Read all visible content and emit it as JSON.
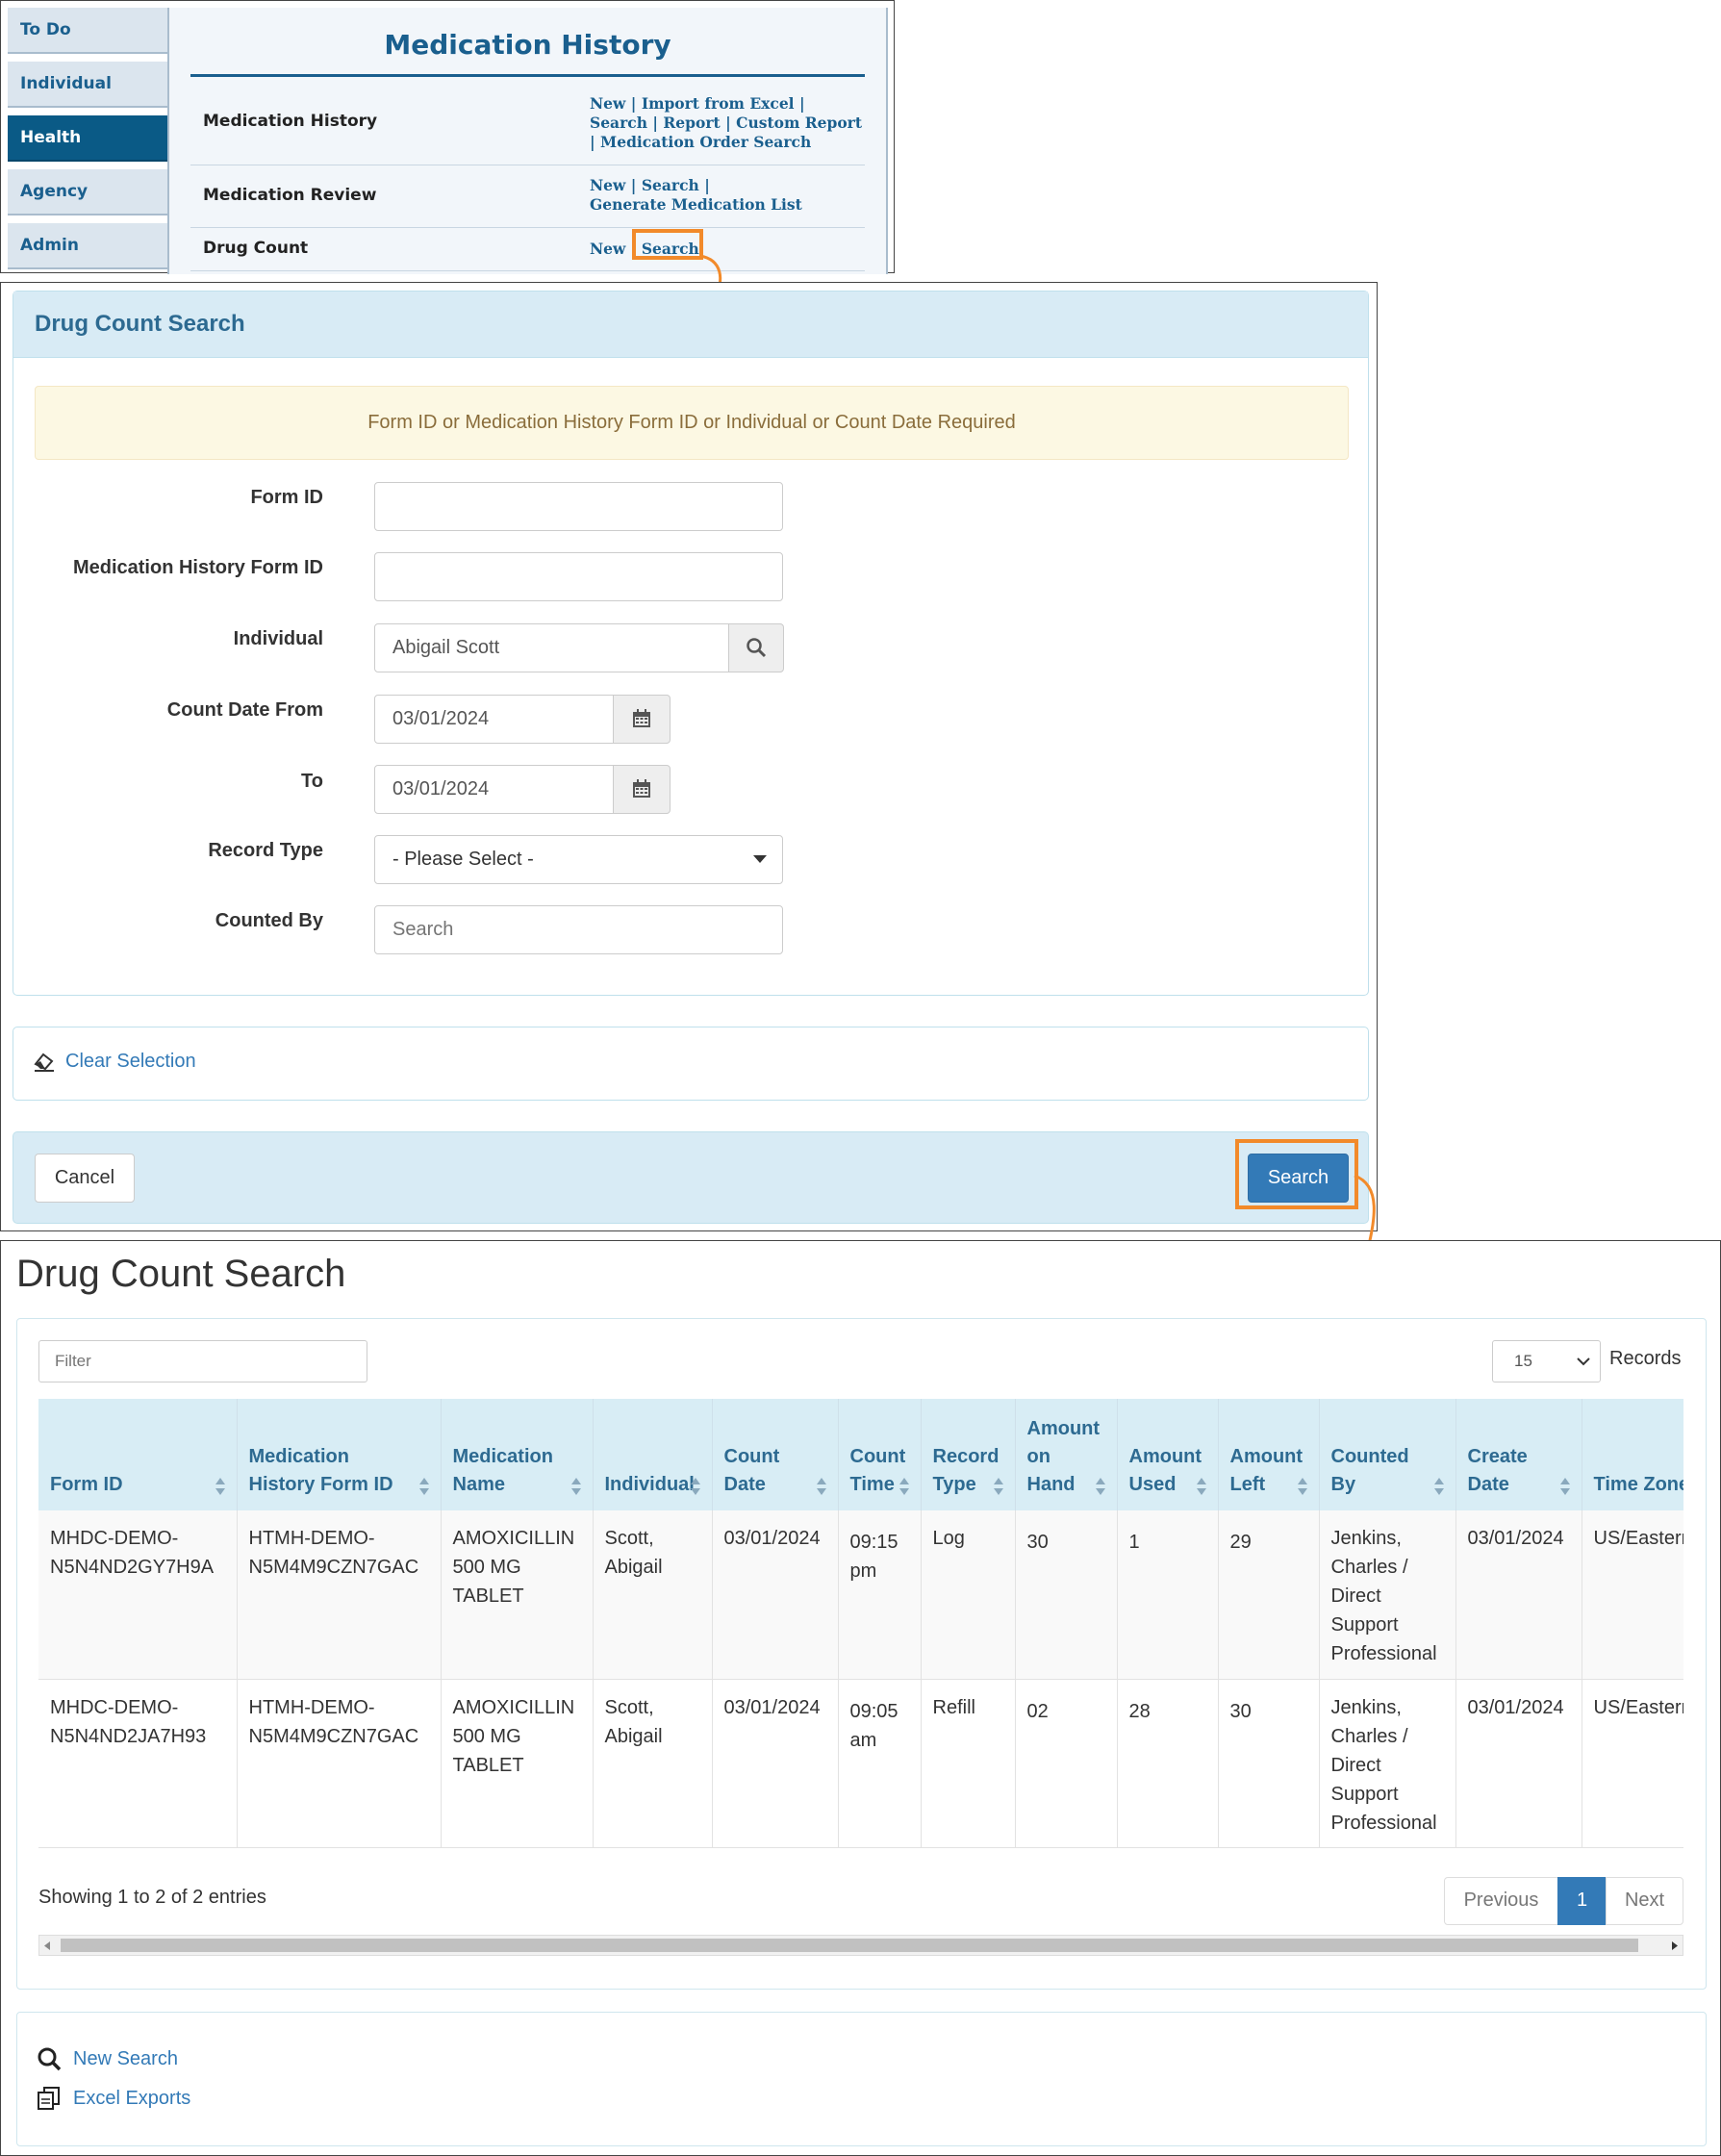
{
  "nav": {
    "tabs": [
      {
        "label": "To Do"
      },
      {
        "label": "Individual"
      },
      {
        "label": "Health"
      },
      {
        "label": "Agency"
      },
      {
        "label": "Admin"
      }
    ],
    "active": "Health"
  },
  "medication_history": {
    "title": "Medication History",
    "rows": [
      {
        "label": "Medication History",
        "links": [
          "New",
          "Import from Excel",
          "Search",
          "Report",
          "Custom Report",
          "Medication Order Search"
        ]
      },
      {
        "label": "Medication Review",
        "links": [
          "New",
          "Search",
          "Generate Medication List"
        ]
      },
      {
        "label": "Drug Count",
        "links": [
          "New",
          "Search"
        ]
      }
    ]
  },
  "search_form": {
    "title": "Drug Count Search",
    "alert": "Form ID or Medication History Form ID or Individual or Count Date Required",
    "fields": {
      "form_id": {
        "label": "Form ID",
        "value": ""
      },
      "med_history_form_id": {
        "label": "Medication History Form ID",
        "value": ""
      },
      "individual": {
        "label": "Individual",
        "value": "Abigail Scott"
      },
      "count_date_from": {
        "label": "Count Date From",
        "value": "03/01/2024"
      },
      "count_date_to": {
        "label": "To",
        "value": "03/01/2024"
      },
      "record_type": {
        "label": "Record Type",
        "value": "- Please Select -"
      },
      "counted_by": {
        "label": "Counted By",
        "placeholder": "Search"
      }
    },
    "clear_selection": "Clear Selection",
    "cancel": "Cancel",
    "search": "Search"
  },
  "results": {
    "title": "Drug Count Search",
    "filter_placeholder": "Filter",
    "page_length": "15",
    "records_label": "Records",
    "columns": [
      {
        "lines": [
          "Form ID"
        ]
      },
      {
        "lines": [
          "Medication",
          "History Form ID"
        ]
      },
      {
        "lines": [
          "Medication",
          "Name"
        ]
      },
      {
        "lines": [
          "Individual"
        ]
      },
      {
        "lines": [
          "Count",
          "Date"
        ]
      },
      {
        "lines": [
          "Count",
          "Time"
        ]
      },
      {
        "lines": [
          "Record",
          "Type"
        ]
      },
      {
        "lines": [
          "Amount",
          "on",
          "Hand"
        ]
      },
      {
        "lines": [
          "Amount",
          "Used"
        ]
      },
      {
        "lines": [
          "Amount",
          "Left"
        ]
      },
      {
        "lines": [
          "Counted",
          "By"
        ]
      },
      {
        "lines": [
          "Create",
          "Date"
        ]
      },
      {
        "lines": [
          "Time Zone"
        ]
      }
    ],
    "rows": [
      {
        "form_id": [
          "MHDC-DEMO-",
          "N5N4ND2GY7H9A"
        ],
        "med_history_form_id": [
          "HTMH-DEMO-",
          "N5M4M9CZN7GAC"
        ],
        "medication_name": [
          "AMOXICILLIN",
          "500 MG",
          "TABLET"
        ],
        "individual": [
          "Scott,",
          "Abigail"
        ],
        "count_date": [
          "03/01/2024"
        ],
        "count_time": [
          "09:15",
          "pm"
        ],
        "record_type": [
          "Log"
        ],
        "amount_on_hand": [
          "30"
        ],
        "amount_used": [
          "1"
        ],
        "amount_left": [
          "29"
        ],
        "counted_by": [
          "Jenkins,",
          "Charles /",
          "Direct",
          "Support",
          "Professional"
        ],
        "create_date": [
          "03/01/2024"
        ],
        "time_zone": [
          "US/Eastern"
        ]
      },
      {
        "form_id": [
          "MHDC-DEMO-",
          "N5N4ND2JA7H93"
        ],
        "med_history_form_id": [
          "HTMH-DEMO-",
          "N5M4M9CZN7GAC"
        ],
        "medication_name": [
          "AMOXICILLIN",
          "500 MG",
          "TABLET"
        ],
        "individual": [
          "Scott,",
          "Abigail"
        ],
        "count_date": [
          "03/01/2024"
        ],
        "count_time": [
          "09:05",
          "am"
        ],
        "record_type": [
          "Refill"
        ],
        "amount_on_hand": [
          "02"
        ],
        "amount_used": [
          "28"
        ],
        "amount_left": [
          "30"
        ],
        "counted_by": [
          "Jenkins,",
          "Charles /",
          "Direct",
          "Support",
          "Professional"
        ],
        "create_date": [
          "03/01/2024"
        ],
        "time_zone": [
          "US/Eastern"
        ]
      }
    ],
    "info": "Showing 1 to 2 of 2 entries",
    "pagination": {
      "previous": "Previous",
      "current": "1",
      "next": "Next"
    },
    "actions": {
      "new_search": "New Search",
      "excel_exports": "Excel Exports"
    }
  },
  "colors": {
    "accent_orange": "#f28a2a",
    "primary_blue": "#337ab7",
    "nav_dark": "#0a5a86",
    "header_text": "#1a5f8e"
  },
  "icons": [
    "search-icon",
    "calendar-icon",
    "caret-down-icon",
    "eraser-icon",
    "sort-icon",
    "copy-icon",
    "arrow-icon"
  ]
}
